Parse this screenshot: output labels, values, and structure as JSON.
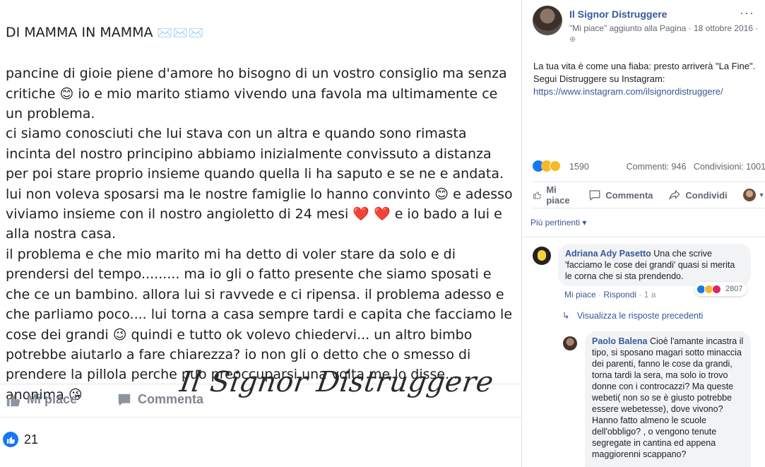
{
  "post_image": {
    "title": "DI MAMMA IN MAMMA",
    "title_emoji": "✉️✉️✉️",
    "lines": [
      "pancine di gioie piene d'amore ho bisogno di un vostro consiglio ma senza",
      "critiche 😊 io e mio marito stiamo vivendo una favola ma ultimamente ce",
      "un problema.",
      "ci siamo conosciuti che lui stava con un altra e quando sono rimasta",
      "incinta del nostro principino abbiamo inizialmente convissuto a distanza",
      "per poi stare proprio insieme quando quella li ha saputo e se ne e andata.",
      "lui non voleva sposarsi ma le nostre famiglie lo hanno convinto 😊 e adesso",
      "viviamo insieme con il nostro angioletto di 24 mesi ❤️ ❤️ e io bado a lui e",
      "alla nostra casa.",
      "il problema e che mio marito mi ha detto di voler stare da solo e di",
      "prendersi del tempo......... ma io gli o fatto presente che siamo sposati e",
      "che ce un bambino. allora lui si ravvede e ci ripensa. il problema adesso e",
      "che parliamo poco.... lui torna a casa sempre tardi e capita che facciamo le",
      "cose dei grandi 😉 quindi e tutto ok volevo chiedervi... un altro bimbo",
      "potrebbe aiutarlo a fare chiarezza? io non gli o detto che o smesso di",
      "prendere la pillola perche puo preoccuparsi una volta me lo disse....",
      "anonima 😘"
    ],
    "like_label": "Mi piace",
    "comment_label": "Commenta",
    "watermark": "Il Signor Distruggere",
    "like_count": "21"
  },
  "sidebar": {
    "page_name": "Il Signor Distruggere",
    "subtitle": "\"Mi piace\" aggiunto alla Pagina · 18 ottobre 2016 ·",
    "caption_line1": "La tua vita è come una fiaba: presto arriverà \"La Fine\".",
    "caption_line2": "Segui Distruggere su Instagram:",
    "caption_link": "https://www.instagram.com/ilsignordistruggere/",
    "reactions_count": "1590",
    "comments_count": "Commenti: 946",
    "shares_count": "Condivisioni: 1001",
    "action_like": "Mi piace",
    "action_comment": "Commenta",
    "action_share": "Condividi",
    "filter_label": "Più pertinenti ▾",
    "comments": [
      {
        "author": "Adriana Ady Pasetto",
        "text": "Una che scrive 'facciamo le cose dei grandi' quasi si merita le corna che si sta prendendo.",
        "like": "Mi piace",
        "reply": "Rispondi",
        "time": "1 a",
        "reactions": "2807"
      },
      {
        "author": "Paolo Balena",
        "text": "Cioè l'amante incastra il tipo, si sposano magari sotto minaccia dei parenti, fanno le cose da grandi, torna tardi la sera, ma solo io trovo donne con i controcazzi? Ma queste webeti( non so se è giusto potrebbe essere webetesse), dove vivono? Hanno fatto almeno le scuole dell'obbligo? , o vengono tenute segregate in cantina ed appena maggiorenni scappano?"
      }
    ],
    "view_previous": "Visualizza le risposte precedenti",
    "colors": {
      "fb_blue": "#385898",
      "like_blue": "#1877f2",
      "bubble_grey": "#f2f3f5"
    }
  }
}
